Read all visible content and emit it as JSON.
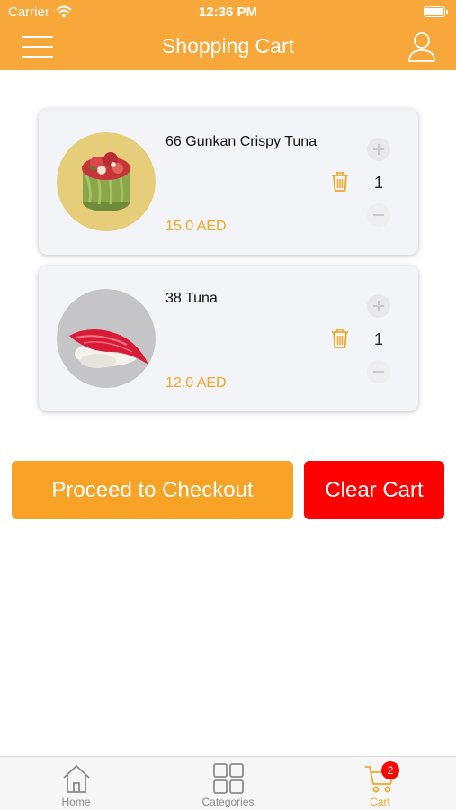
{
  "status_bar": {
    "carrier": "Carrier",
    "time": "12:36 PM"
  },
  "header": {
    "title": "Shopping Cart",
    "menu_icon": "hamburger-icon",
    "user_icon": "user-icon"
  },
  "colors": {
    "brand": "#f8a83a",
    "checkout": "#f8a226",
    "clear": "#ff0000",
    "price": "#f5a623"
  },
  "cart": {
    "items": [
      {
        "name": "66 Gunkan Crispy Tuna",
        "price": "15.0 AED",
        "quantity": "1"
      },
      {
        "name": "38 Tuna",
        "price": "12.0 AED",
        "quantity": "1"
      }
    ]
  },
  "actions": {
    "checkout_label": "Proceed to Checkout",
    "clear_label": "Clear Cart"
  },
  "tabbar": {
    "tabs": [
      {
        "label": "Home",
        "icon": "home-icon"
      },
      {
        "label": "Categories",
        "icon": "grid-icon"
      },
      {
        "label": "Cart",
        "icon": "cart-icon",
        "badge": "2"
      }
    ]
  }
}
